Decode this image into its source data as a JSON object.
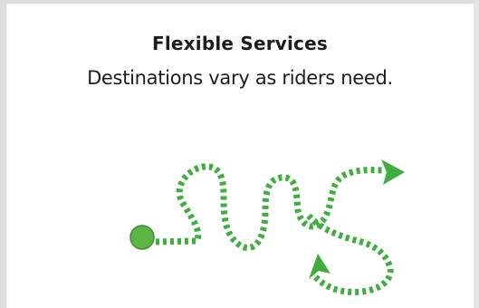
{
  "header": {
    "title": "Flexible Services",
    "subtitle": "Destinations vary as riders need."
  },
  "colors": {
    "route": "#3fae3f",
    "start_dot": "#5cb545",
    "start_dot_edge": "#3c8f2e",
    "border": "#dedede"
  },
  "icons": {
    "start": "start-point-icon",
    "arrow_upper": "arrow-right-icon",
    "arrow_lower": "arrow-up-left-icon"
  }
}
